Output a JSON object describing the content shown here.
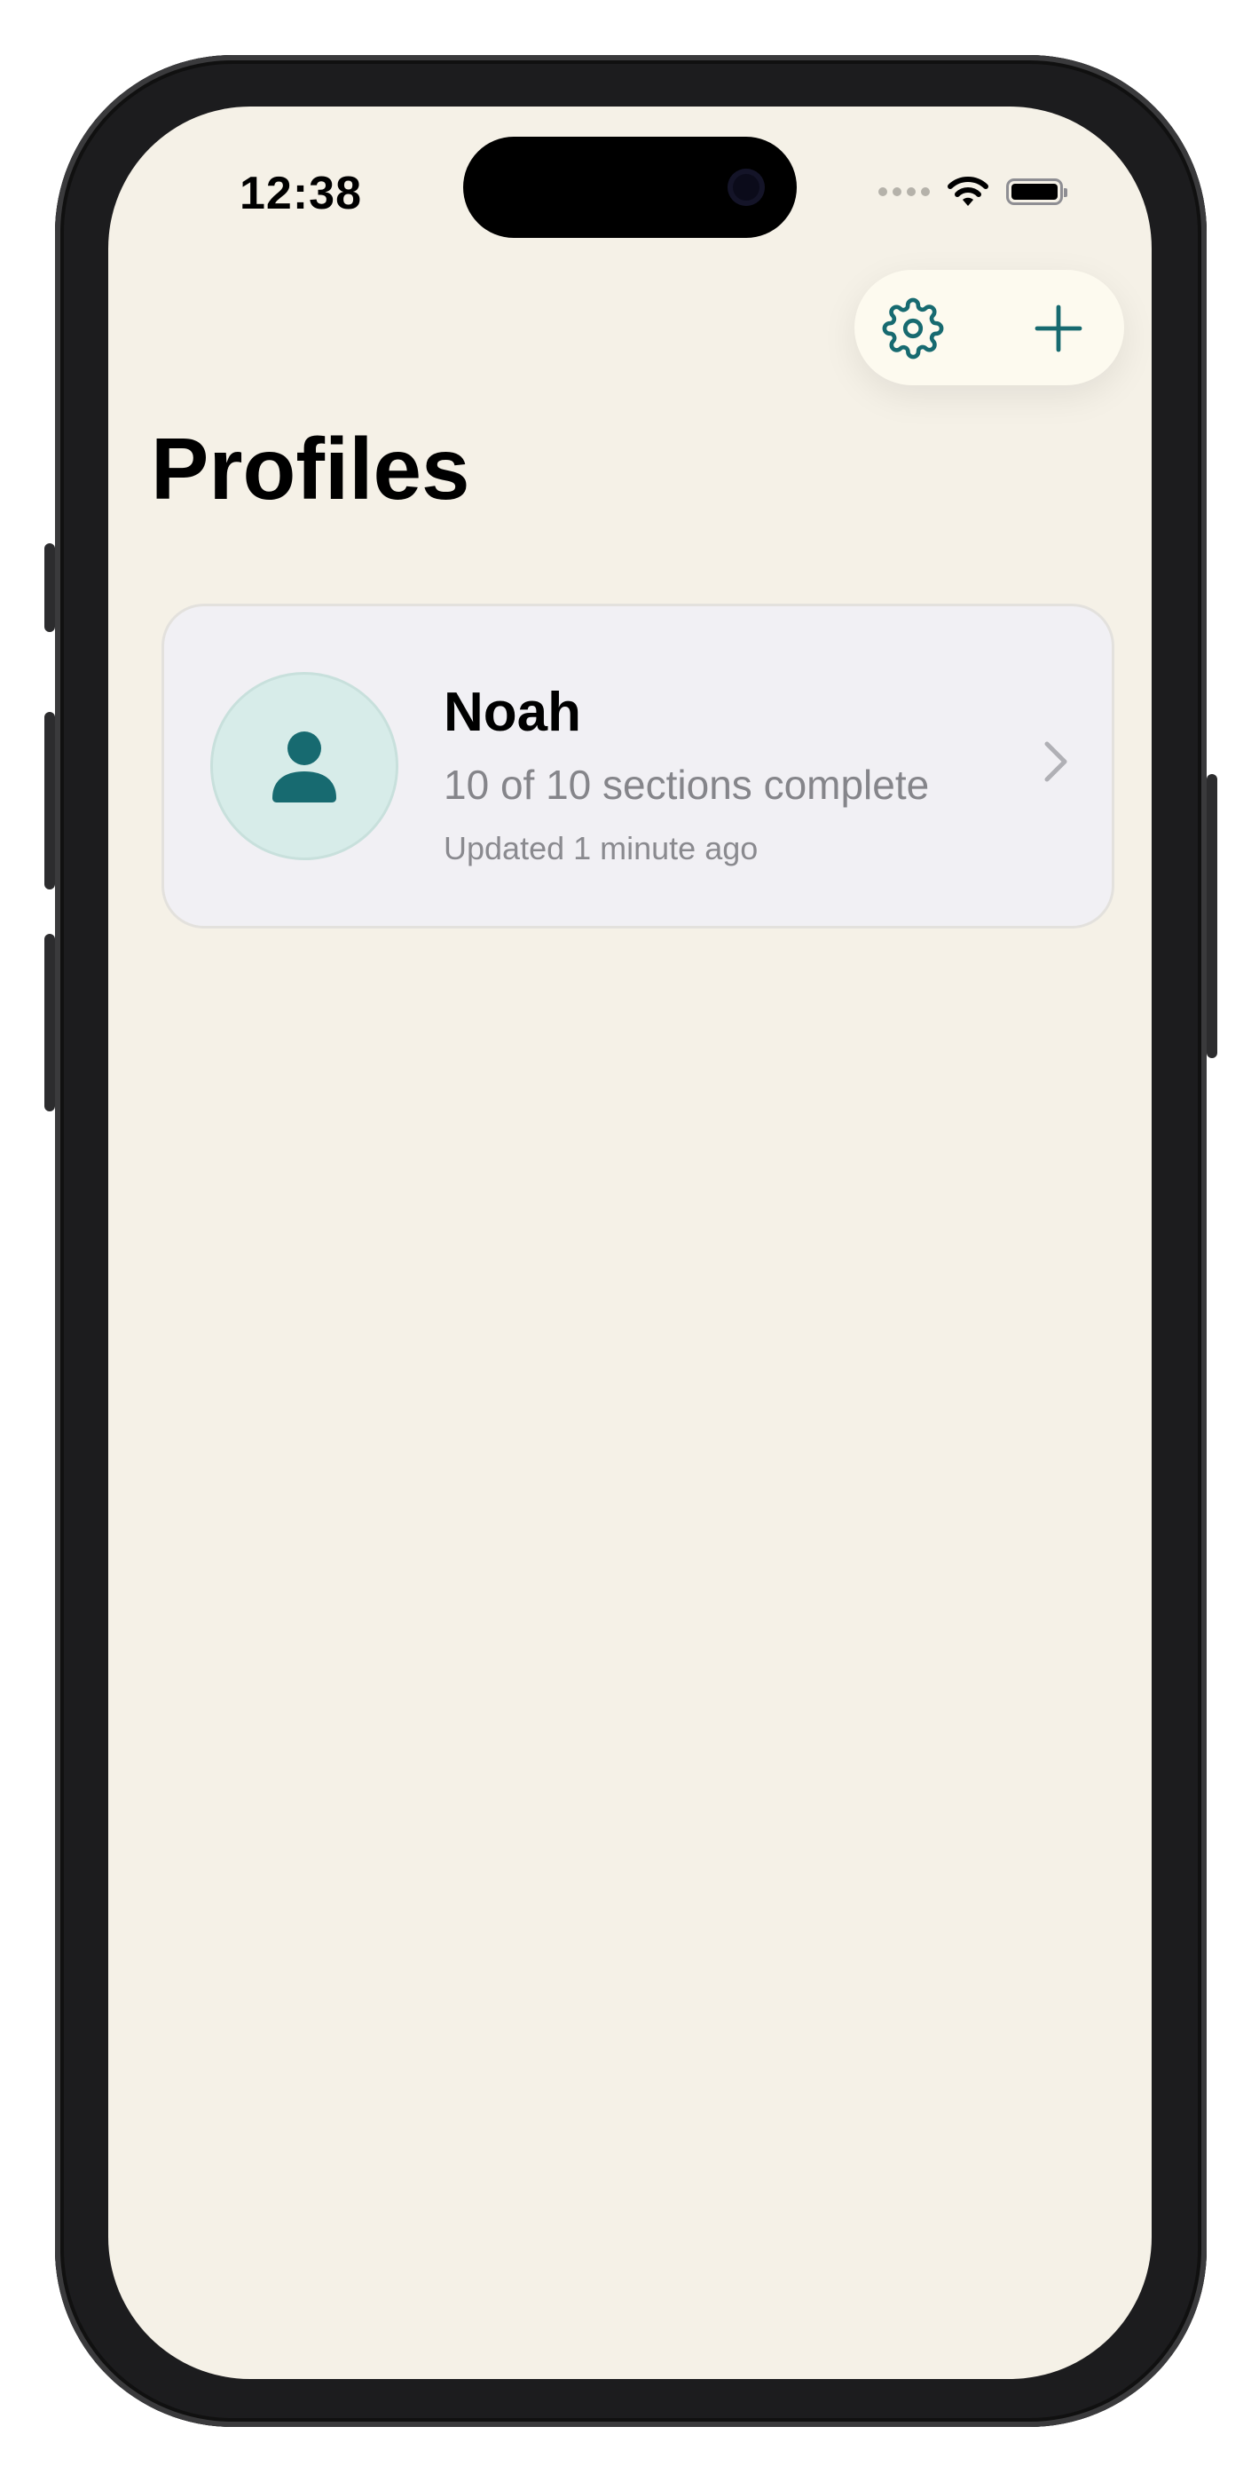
{
  "status_bar": {
    "time": "12:38"
  },
  "toolbar": {
    "settings_icon": "gear-icon",
    "add_icon": "plus-icon",
    "accent_color": "#176a70"
  },
  "page": {
    "title": "Profiles"
  },
  "profiles": [
    {
      "name": "Noah",
      "progress": "10 of 10 sections complete",
      "updated": "Updated 1 minute ago",
      "avatar_icon": "person-icon"
    }
  ],
  "colors": {
    "background": "#f5f1e7",
    "card": "#f1f0f4",
    "avatar_bg": "#d7ece9",
    "secondary_text": "#85858a"
  }
}
